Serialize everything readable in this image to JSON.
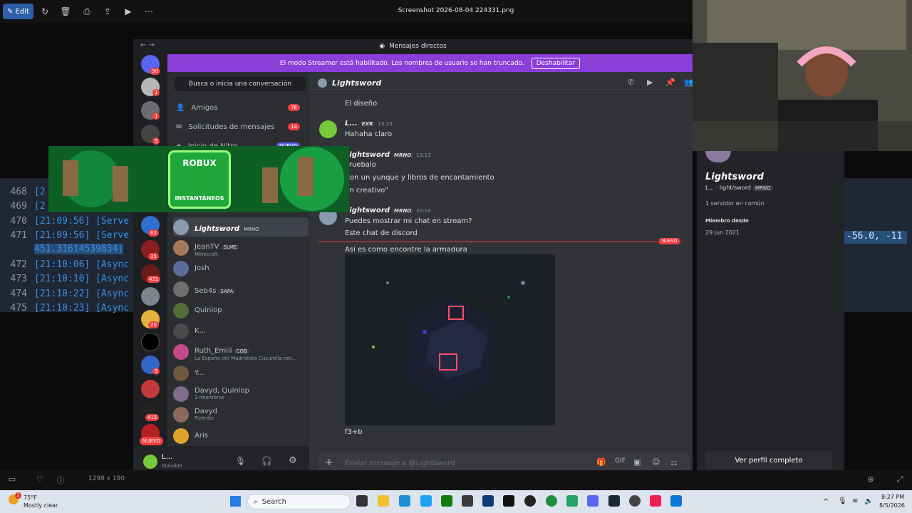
{
  "viewer": {
    "edit_label": "Edit",
    "file_title": "Screenshot 2026-08-04 224331.png",
    "image_size": "1298 x 190"
  },
  "editor": {
    "lines": [
      {
        "n": "468",
        "t": "[2"
      },
      {
        "n": "469",
        "t": "[2"
      },
      {
        "n": "470",
        "t": "[21:09:56] [Serve"
      },
      {
        "n": "471",
        "t": "[21:09:56] [Serve"
      },
      {
        "n": "",
        "t": "451.31614539834)"
      },
      {
        "n": "472",
        "t": "[21:10:06] [Async"
      },
      {
        "n": "473",
        "t": "[21:10:10] [Async"
      },
      {
        "n": "474",
        "t": "[21:10:22] [Async"
      },
      {
        "n": "475",
        "t": "[21:10:23] [Async"
      }
    ],
    "right_text": "-56.0, -11"
  },
  "discord": {
    "window_title": "Mensajes directos",
    "streamer_notice": "El modo Streamer está habilitado. Los nombres de usuario se han truncado.",
    "streamer_button": "Deshabilitar",
    "search_placeholder": "Busca o inicia una conversación",
    "nav": [
      {
        "label": "Amigos",
        "count": "76"
      },
      {
        "label": "Solicitudes de mensajes",
        "count": "14"
      },
      {
        "label": "Inicio de Nitro",
        "count": "NUEVO"
      }
    ],
    "server_badges": [
      "90",
      "1",
      "1",
      "5",
      "62",
      "35",
      "421",
      "20",
      "5",
      "415"
    ],
    "server_new": "NUEVO",
    "dms": [
      {
        "name": "Lightsword",
        "tag": "MRNO",
        "sub": ""
      },
      {
        "name": "JeanTV",
        "tag": "SLME",
        "sub": "Minecraft"
      },
      {
        "name": "Josh",
        "tag": "",
        "sub": ""
      },
      {
        "name": "Seb4s",
        "tag": "SAPA",
        "sub": ""
      },
      {
        "name": "Quiniop",
        "tag": "",
        "sub": ""
      },
      {
        "name": "K...",
        "tag": "",
        "sub": ""
      },
      {
        "name": "Ruth_Emiii",
        "tag": "COB",
        "sub": "La España del Madridista Cucurella reti..."
      },
      {
        "name": "Y...",
        "tag": "",
        "sub": ""
      },
      {
        "name": "Davyd, Quiniop",
        "tag": "",
        "sub": "3 miembros"
      },
      {
        "name": "Davyd",
        "tag": "",
        "sub": "Fortnite"
      },
      {
        "name": "Aris",
        "tag": "",
        "sub": ""
      }
    ],
    "user": {
      "name": "L...",
      "status": "Invisible"
    },
    "chat_header": "Lightsword",
    "messages": {
      "m1": "El diseño",
      "m2_name": "L...",
      "m2_tag": "EXR",
      "m2_time": "13:13",
      "m2_text": "Hahaha claro",
      "m3_name": "Lightsword",
      "m3_tag": "MRNO",
      "m3_time": "13:13",
      "m3_l1": "Pruebalo",
      "m3_l2": "Con un yunque y libros de encantamiento",
      "m3_l3": "En creativo\"",
      "m4_name": "Lightsword",
      "m4_tag": "MRNO",
      "m4_time": "20:19",
      "m4_l1": "Puedes mostrar mi chat en stream?",
      "m4_l2": "Este chat de discord",
      "new_label": "NUEVO",
      "m5": "Asi es como encontre la armadura",
      "m6": "f3+b"
    },
    "input_placeholder": "Enviar mensaje a @Lightsword",
    "profile": {
      "name": "Lightsword",
      "handle": "L... · light/sword",
      "tag": "MRNO",
      "mutual": "1 servidor en común",
      "member_since_label": "Miembro desde",
      "member_since": "29 jun 2021",
      "view_button": "Ver perfil completo"
    }
  },
  "ad": {
    "line1": "ROBUX",
    "line2": "INSTANTÁNEOS"
  },
  "taskbar": {
    "weather_temp": "75°F",
    "weather_desc": "Mostly clear",
    "search": "Search",
    "time": "8:27 PM",
    "date": "8/5/2026",
    "weather_badge": "2"
  },
  "colors": {
    "accent": "#5865f2",
    "streamer": "#8a3fd9",
    "danger": "#f23f42"
  }
}
